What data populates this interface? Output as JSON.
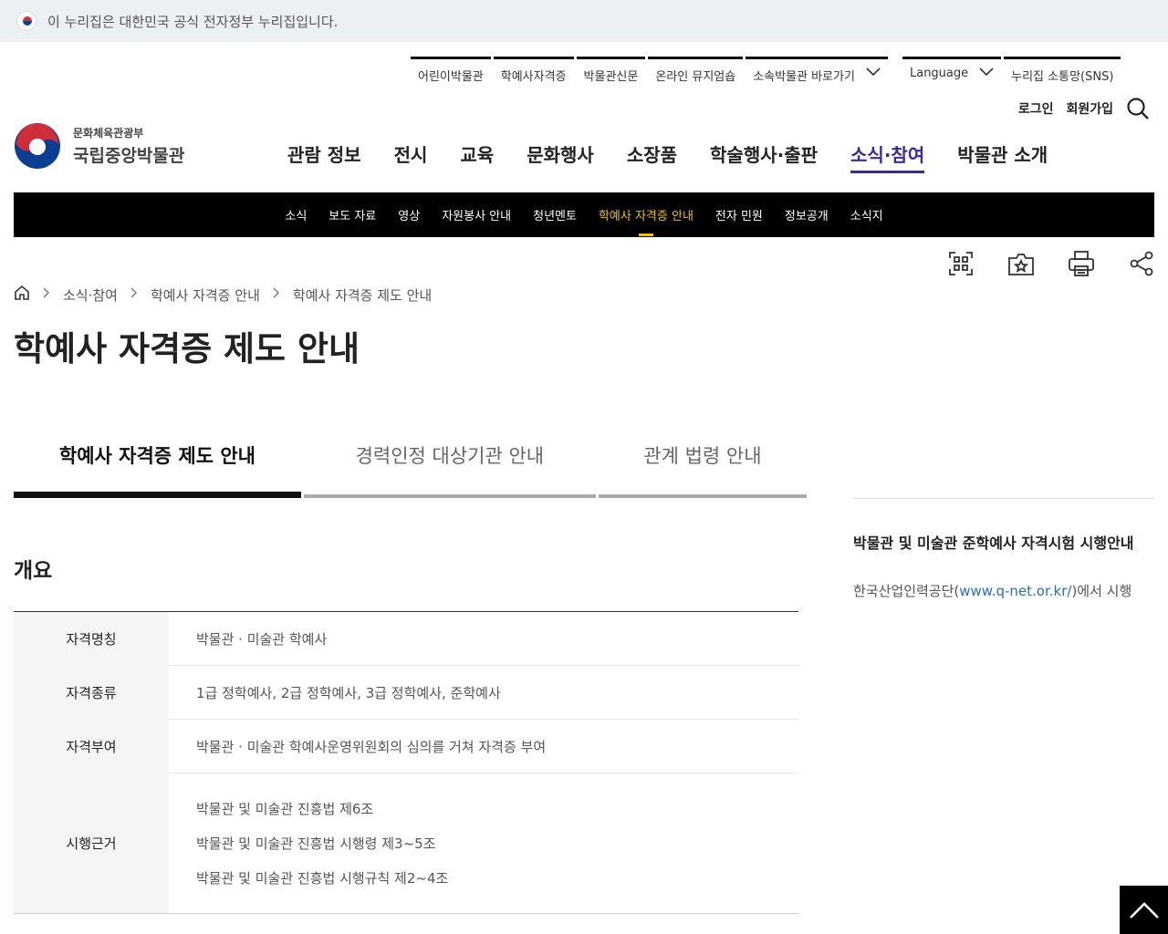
{
  "gov_banner": {
    "text": "이 누리집은 대한민국 공식 전자정부 누리집입니다."
  },
  "util_nav": {
    "items": [
      "어린이박물관",
      "학예사자격증",
      "박물관신문",
      "온라인 뮤지엄숍",
      "소속박물관 바로가기"
    ],
    "language": "Language",
    "sns": "누리집 소통망(SNS)"
  },
  "auth": {
    "login": "로그인",
    "signup": "회원가입"
  },
  "logo": {
    "ministry": "문화체육관광부",
    "name": "국립중앙박물관"
  },
  "gnb": {
    "items": [
      "관람 정보",
      "전시",
      "교육",
      "문화행사",
      "소장품",
      "학술행사·출판",
      "소식·참여",
      "박물관 소개"
    ],
    "active": "소식·참여"
  },
  "sub_nav": {
    "items": [
      "소식",
      "보도 자료",
      "영상",
      "자원봉사 안내",
      "청년멘토",
      "학예사 자격증 안내",
      "전자 민원",
      "정보공개",
      "소식지"
    ],
    "active": "학예사 자격증 안내"
  },
  "breadcrumb": [
    "소식·참여",
    "학예사 자격증 안내",
    "학예사 자격증 제도 안내"
  ],
  "page_title": "학예사 자격증 제도 안내",
  "tabs": [
    "학예사 자격증 제도 안내",
    "경력인정 대상기관 안내",
    "관계 법령 안내"
  ],
  "section_title": "개요",
  "table": {
    "rows": [
      {
        "label": "자격명칭",
        "value": "박물관 · 미술관 학예사"
      },
      {
        "label": "자격종류",
        "value": "1급 정학예사, 2급 정학예사, 3급 정학예사, 준학예사"
      },
      {
        "label": "자격부여",
        "value": "박물관 · 미술관 학예사운영위원회의 심의를 거쳐 자격증 부여"
      },
      {
        "label": "시행근거",
        "values": [
          "박물관 및 미술관 진흥법 제6조",
          "박물관 및 미술관 진흥법 시행령 제3~5조",
          "박물관 및 미술관 진흥법 시행규칙 제2~4조"
        ]
      }
    ]
  },
  "side": {
    "title": "박물관 및 미술관 준학예사 자격시험 시행안내",
    "desc_prefix": "한국산업인력공단(",
    "link": "www.q-net.or.kr/",
    "desc_suffix": ")에서 시행"
  },
  "colors": {
    "accent": "#3b2a9a",
    "highlight": "#f2c200",
    "link": "#2a6cc4"
  },
  "icons": [
    "qr-code-icon",
    "bookmark-star-icon",
    "print-icon",
    "share-icon",
    "home-icon",
    "search-icon",
    "arrow-up-icon"
  ]
}
